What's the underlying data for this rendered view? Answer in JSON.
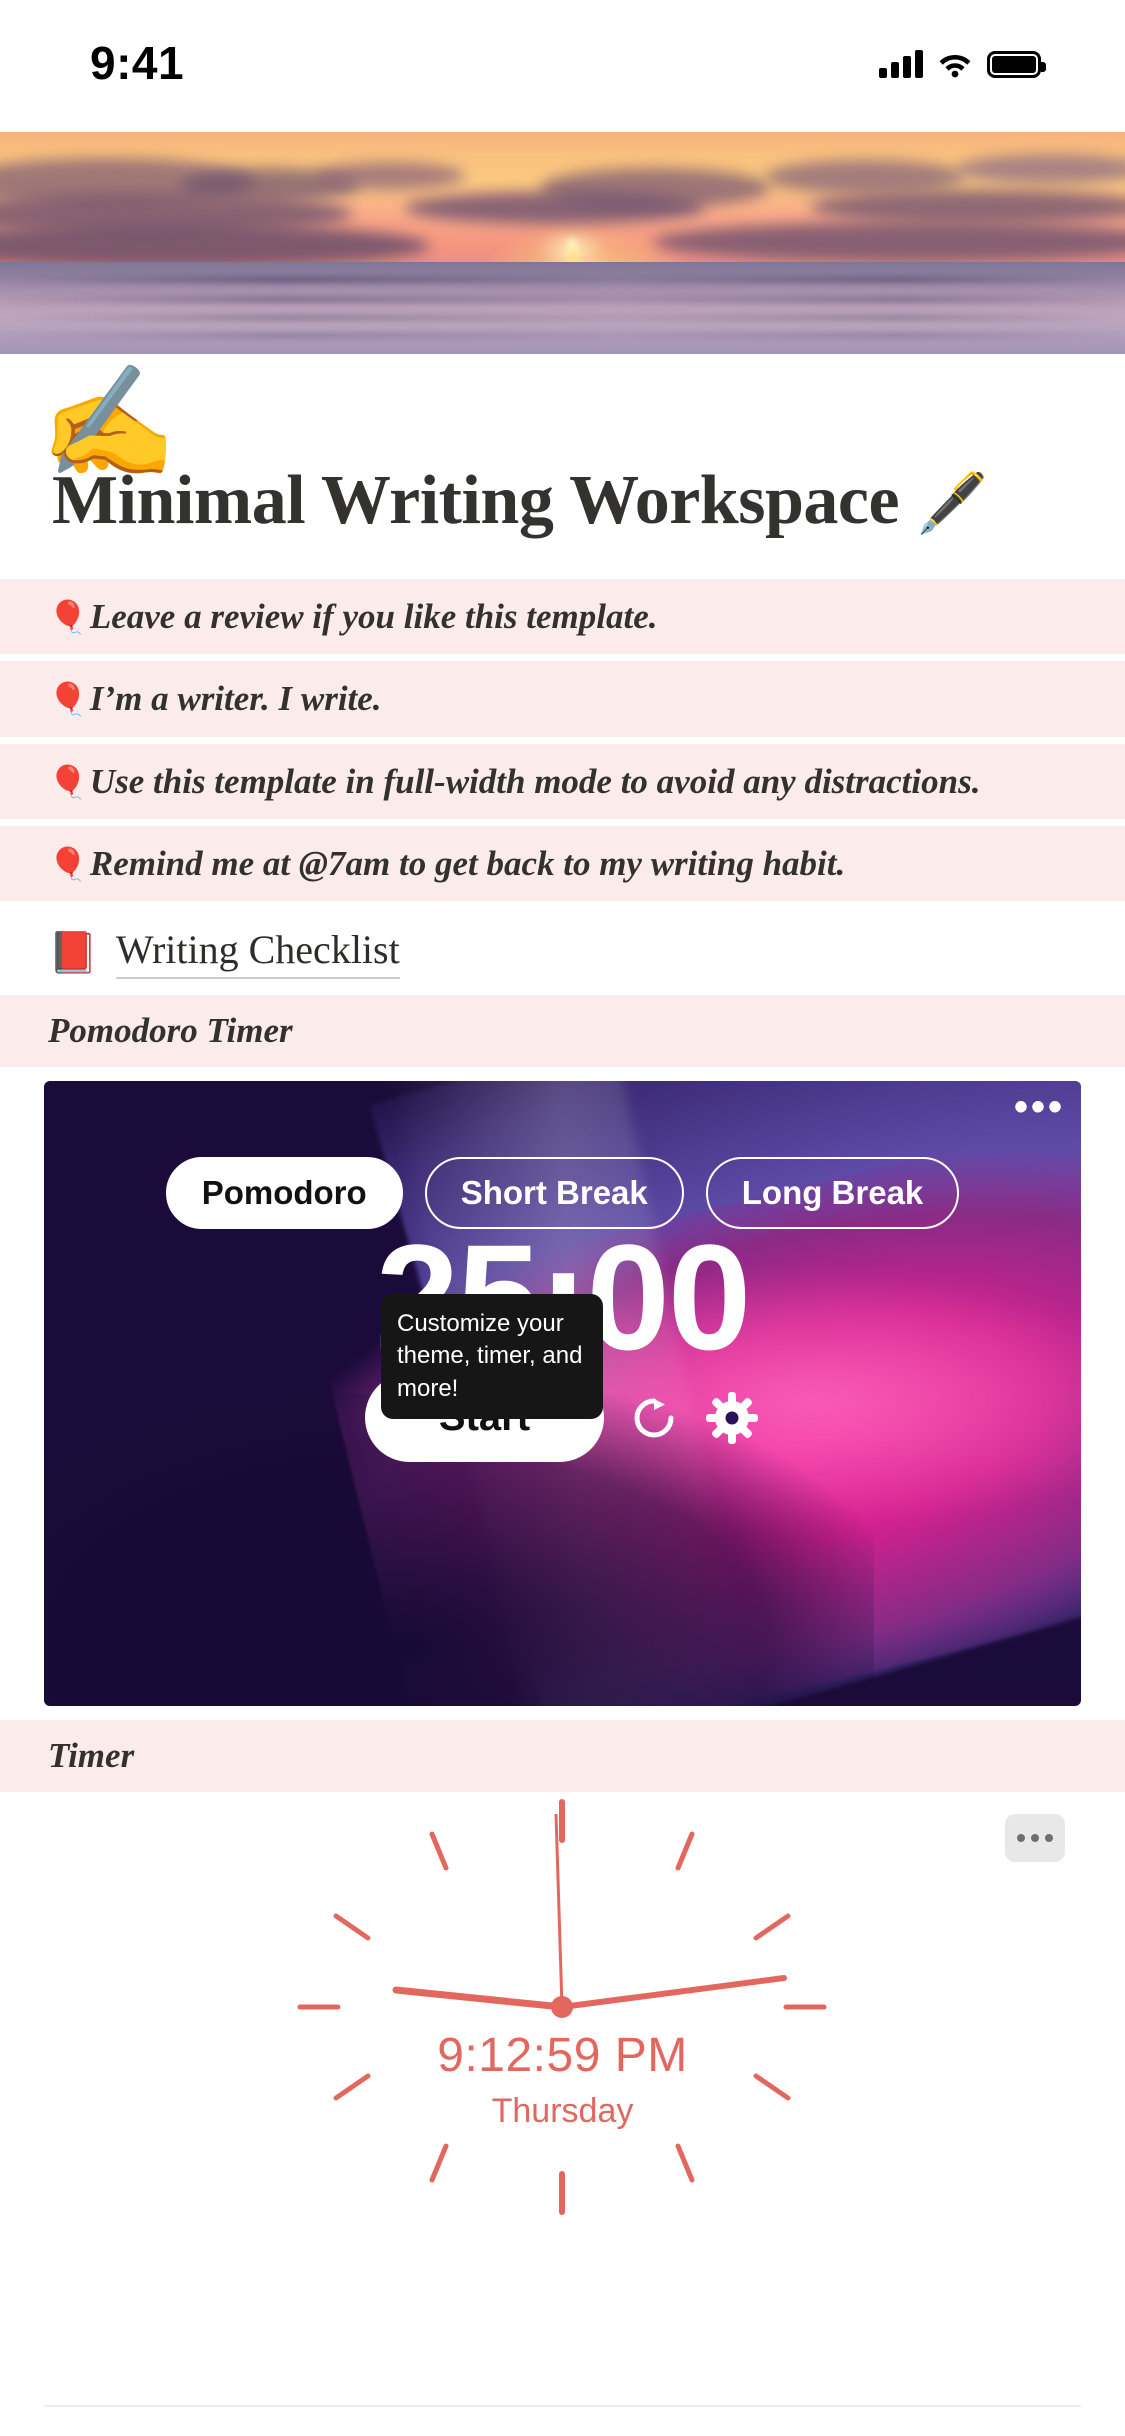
{
  "statusbar": {
    "time": "9:41",
    "signal_icon": "cellular-signal-icon",
    "wifi_icon": "wifi-icon",
    "battery_icon": "battery-full-icon"
  },
  "cover": {
    "alt": "sunset over ocean cover photo"
  },
  "page": {
    "emoji": "✍️",
    "title": "Minimal Writing Workspace",
    "title_emoji": "🖋️"
  },
  "callouts": [
    {
      "emoji": "🎈",
      "text": "Leave a review if you like this template."
    },
    {
      "emoji": "🎈",
      "text": "I’m a writer. I write."
    },
    {
      "emoji": "🎈",
      "text": "Use this template in full-width mode to avoid any distractions."
    },
    {
      "emoji": "🎈",
      "text": "Remind me at @7am to get back to my writing habit."
    }
  ],
  "checklist": {
    "emoji": "📕",
    "label": "Writing Checklist"
  },
  "sections": {
    "pomodoro_label": "Pomodoro Timer",
    "timer_label": "Timer"
  },
  "pomodoro": {
    "menu_icon": "more-options-icon",
    "tabs": [
      {
        "label": "Pomodoro",
        "active": true
      },
      {
        "label": "Short Break",
        "active": false
      },
      {
        "label": "Long Break",
        "active": false
      }
    ],
    "time": "25:00",
    "tooltip": "Customize your theme, timer, and more!",
    "start_label": "Start",
    "reset_icon": "reset-icon",
    "settings_icon": "gear-icon"
  },
  "clock": {
    "menu_icon": "more-options-icon",
    "digital_time": "9:12:59 PM",
    "day": "Thursday",
    "accent_color": "#e2685f",
    "hour_hand_deg": 104,
    "minute_hand_deg": 72,
    "second_hand_deg": 354
  },
  "colors": {
    "callout_bg": "#fbeceb",
    "text_dark": "#33312d",
    "pomodoro_accent": "#ef2aa0",
    "clock_accent": "#e2685f"
  }
}
